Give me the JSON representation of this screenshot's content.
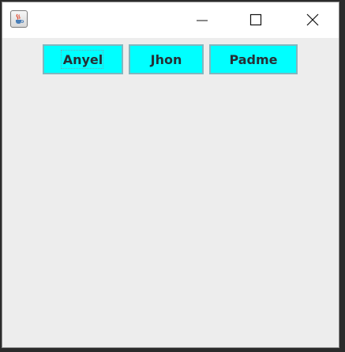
{
  "window": {
    "title": "",
    "controls": {
      "minimize_icon": "minimize-icon",
      "maximize_icon": "maximize-icon",
      "close_icon": "close-icon"
    },
    "app_icon": "java-coffee-icon"
  },
  "buttons": [
    {
      "label": "Anyel",
      "focused": true
    },
    {
      "label": "Jhon",
      "focused": false
    },
    {
      "label": "Padme",
      "focused": false
    }
  ],
  "colors": {
    "button_background": "#00ffff",
    "button_border": "#7fb7bf",
    "content_background": "#ededed",
    "titlebar_background": "#ffffff"
  }
}
